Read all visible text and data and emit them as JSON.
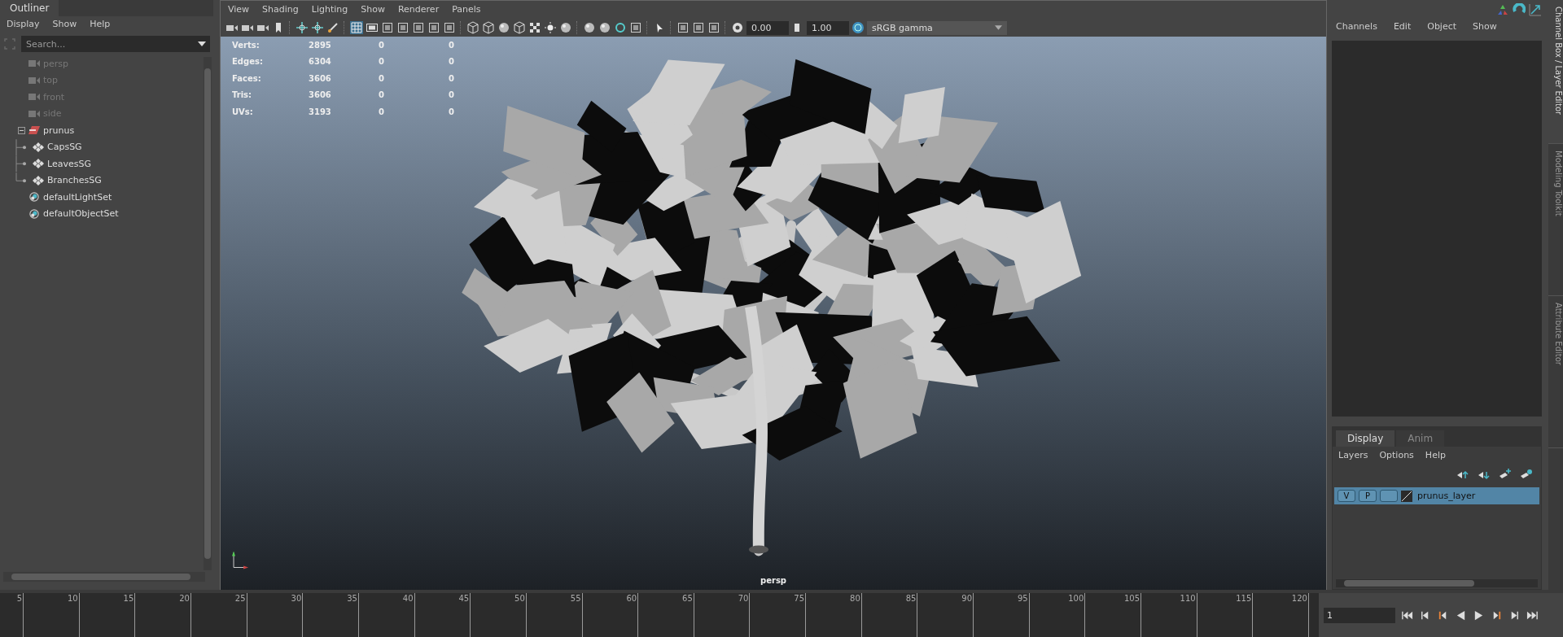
{
  "outliner": {
    "tab": "Outliner",
    "menu": [
      "Display",
      "Show",
      "Help"
    ],
    "search": {
      "placeholder": "Search..."
    },
    "items": [
      {
        "label": "persp",
        "kind": "camera",
        "dimmed": true
      },
      {
        "label": "top",
        "kind": "camera",
        "dimmed": true
      },
      {
        "label": "front",
        "kind": "camera",
        "dimmed": true
      },
      {
        "label": "side",
        "kind": "camera",
        "dimmed": true
      },
      {
        "label": "prunus",
        "kind": "transform",
        "dimmed": false,
        "expanded": true,
        "children": [
          {
            "label": "CapsSG",
            "kind": "shading",
            "dimmed": false
          },
          {
            "label": "LeavesSG",
            "kind": "shading",
            "dimmed": false
          },
          {
            "label": "BranchesSG",
            "kind": "shading",
            "dimmed": false
          }
        ]
      },
      {
        "label": "defaultLightSet",
        "kind": "set",
        "dimmed": false
      },
      {
        "label": "defaultObjectSet",
        "kind": "set",
        "dimmed": false
      }
    ]
  },
  "viewport": {
    "menu": [
      "View",
      "Shading",
      "Lighting",
      "Show",
      "Renderer",
      "Panels"
    ],
    "exposure": "0.00",
    "gamma": "1.00",
    "color_space": "sRGB gamma",
    "hud": [
      {
        "label": "Verts:",
        "values": [
          "2895",
          "0",
          "0"
        ]
      },
      {
        "label": "Edges:",
        "values": [
          "6304",
          "0",
          "0"
        ]
      },
      {
        "label": "Faces:",
        "values": [
          "3606",
          "0",
          "0"
        ]
      },
      {
        "label": "Tris:",
        "values": [
          "3606",
          "0",
          "0"
        ]
      },
      {
        "label": "UVs:",
        "values": [
          "3193",
          "0",
          "0"
        ]
      }
    ],
    "camera": "persp"
  },
  "channel_box": {
    "menu": [
      "Channels",
      "Edit",
      "Object",
      "Show"
    ]
  },
  "layer_editor": {
    "tabs": [
      {
        "label": "Display",
        "selected": true
      },
      {
        "label": "Anim",
        "selected": false
      }
    ],
    "menu": [
      "Layers",
      "Options",
      "Help"
    ],
    "layers": [
      {
        "visible": "V",
        "playback": "P",
        "name": "prunus_layer",
        "selected": true
      }
    ]
  },
  "side_tabs": [
    {
      "label": "Channel Box / Layer Editor",
      "selected": true
    },
    {
      "label": "Modeling Toolkit",
      "selected": false
    },
    {
      "label": "Attribute Editor",
      "selected": false
    }
  ],
  "timeline": {
    "ticks": [
      "5",
      "10",
      "15",
      "20",
      "25",
      "30",
      "35",
      "40",
      "45",
      "50",
      "55",
      "60",
      "65",
      "70",
      "75",
      "80",
      "85",
      "90",
      "95",
      "100",
      "105",
      "110",
      "115",
      "120"
    ],
    "current_frame": "1"
  }
}
